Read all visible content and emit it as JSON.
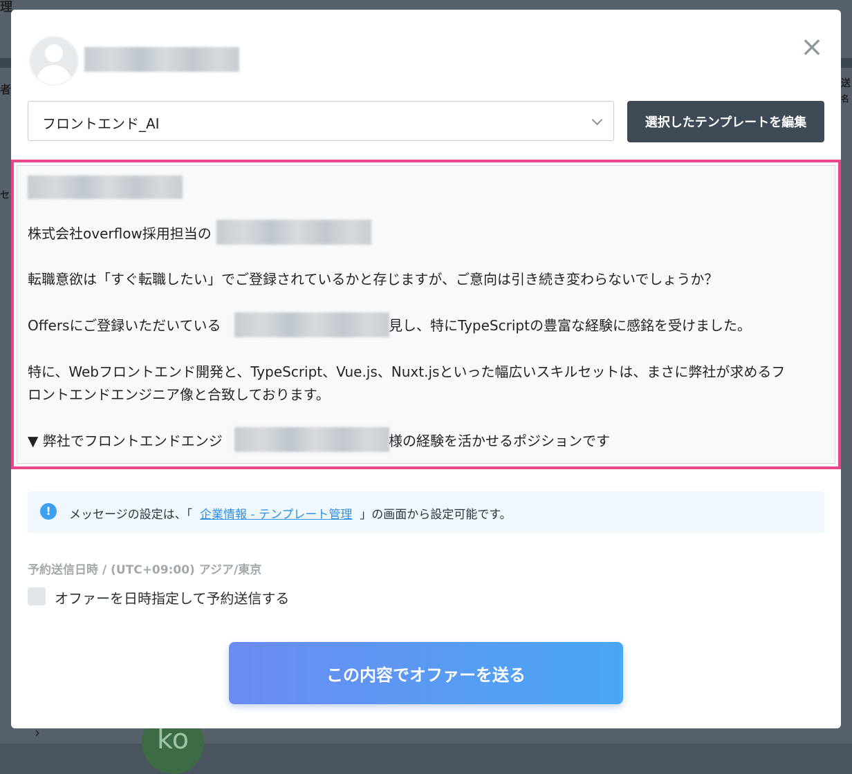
{
  "background": {
    "fragment_top": "理",
    "fragment_left_a": "者",
    "fragment_left_b": "セ",
    "fragment_right_a": "送",
    "fragment_right_b": "名",
    "avatar_text": "ko"
  },
  "modal": {
    "close_icon": "×",
    "template_select": {
      "value": "フロントエンド_AI"
    },
    "edit_template_button": "選択したテンプレートを編集",
    "message": {
      "line_sender_prefix": "株式会社overflow採用担当の",
      "line_question": "転職意欲は「すぐ転職したい」でご登録されているかと存じますが、ご意向は引き続き変わらないでしょうか？",
      "line_profile_prefix": "Offersにご登録いただいている",
      "line_profile_suffix": "見し、特にTypeScriptの豊富な経験に感銘を受けました。",
      "line_skills_1": "特に、Webフロントエンド開発と、TypeScript、Vue.js、Nuxt.jsといった幅広いスキルセットは、まさに弊社が求めるフ",
      "line_skills_2": "ロントエンドエンジニア像と合致しております。",
      "line_position_prefix": "▼ 弊社でフロントエンドエンジ",
      "line_position_suffix": "様の経験を活かせるポジションです"
    },
    "info": {
      "icon": "!",
      "prefix": "メッセージの設定は、「",
      "link": "企業情報 - テンプレート管理",
      "suffix": "」の画面から設定可能です。"
    },
    "schedule_label": "予約送信日時 / (UTC+09:00) アジア/東京",
    "schedule_checkbox_label": "オファーを日時指定して予約送信する",
    "send_button": "この内容でオファーを送る"
  },
  "colors": {
    "highlight_border": "#e8458b",
    "primary_dark": "#3e4b57",
    "link": "#2f8fe3",
    "send_gradient_start": "#6b8bf1",
    "send_gradient_end": "#4aa7f4"
  }
}
